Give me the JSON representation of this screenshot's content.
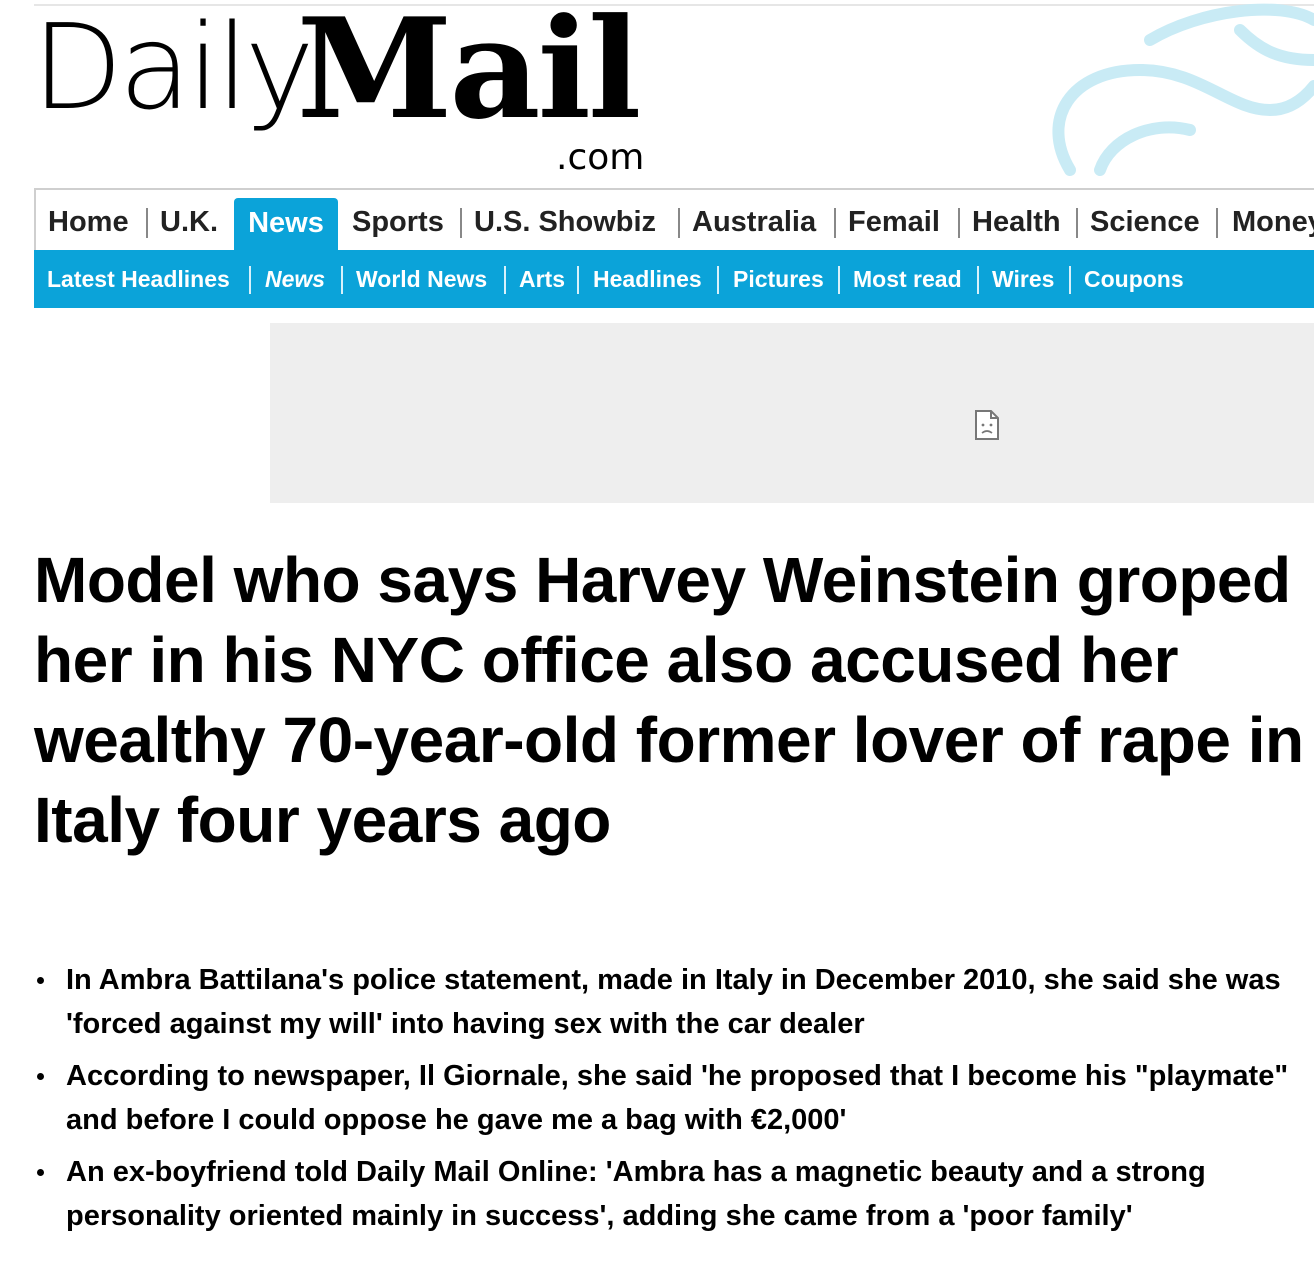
{
  "masthead": {
    "logo_daily": "Daily",
    "logo_mail": "Mail",
    "logo_com": ".com"
  },
  "primary_nav": {
    "items": [
      "Home",
      "U.K.",
      "News",
      "Sports",
      "U.S. Showbiz",
      "Australia",
      "Femail",
      "Health",
      "Science",
      "Money"
    ],
    "active": "News",
    "active_color": "#0ba3d9"
  },
  "secondary_nav": {
    "items": [
      "Latest Headlines",
      "News",
      "World News",
      "Arts",
      "Headlines",
      "Pictures",
      "Most read",
      "Wires",
      "Coupons"
    ],
    "active": "News",
    "background": "#0ba3d9"
  },
  "ad": {
    "icon": "broken-image-icon"
  },
  "article": {
    "headline": "Model who says Harvey Weinstein groped her in his NYC office also accused her wealthy 70-year-old former lover of rape in Italy four years ago",
    "bullets": [
      "In Ambra Battilana's police statement, made in Italy in December 2010, she said she was 'forced against my will' into having sex with the car dealer",
      "According to newspaper, Il Giornale, she said 'he proposed that I become his \"playmate\" and before I could oppose he gave me a bag with €2,000'",
      "An ex-boyfriend told Daily Mail Online: 'Ambra has a magnetic beauty and a strong personality oriented mainly in success', adding she came from a 'poor family'"
    ]
  }
}
